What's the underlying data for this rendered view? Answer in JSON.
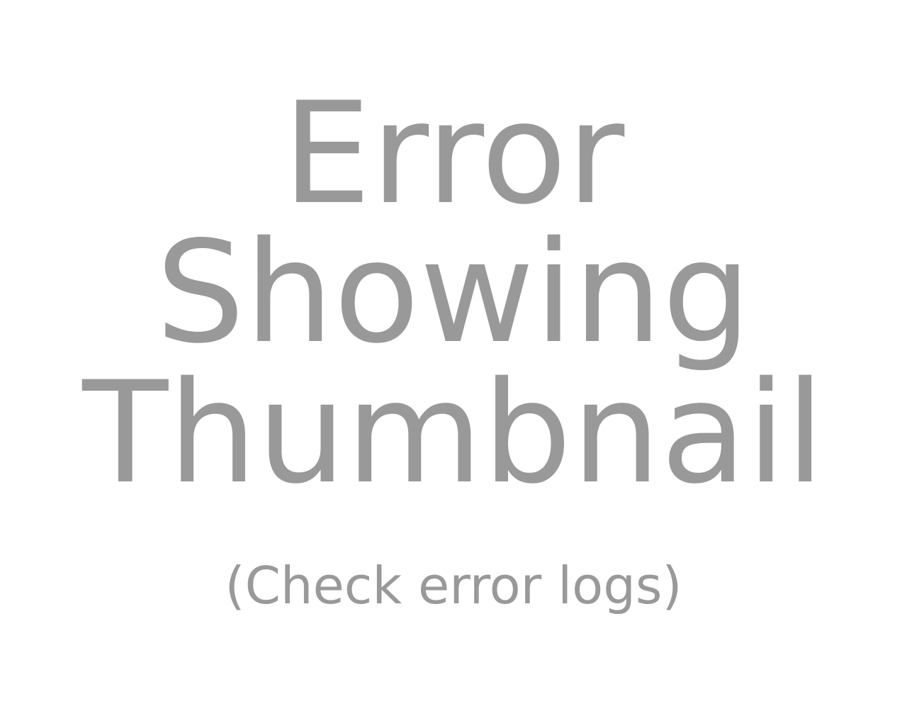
{
  "message": {
    "lines": [
      "Error",
      "Showing",
      "Thumbnail"
    ],
    "note": "(Check error logs)",
    "text_color": "#999999",
    "background_color": "#ffffff"
  }
}
